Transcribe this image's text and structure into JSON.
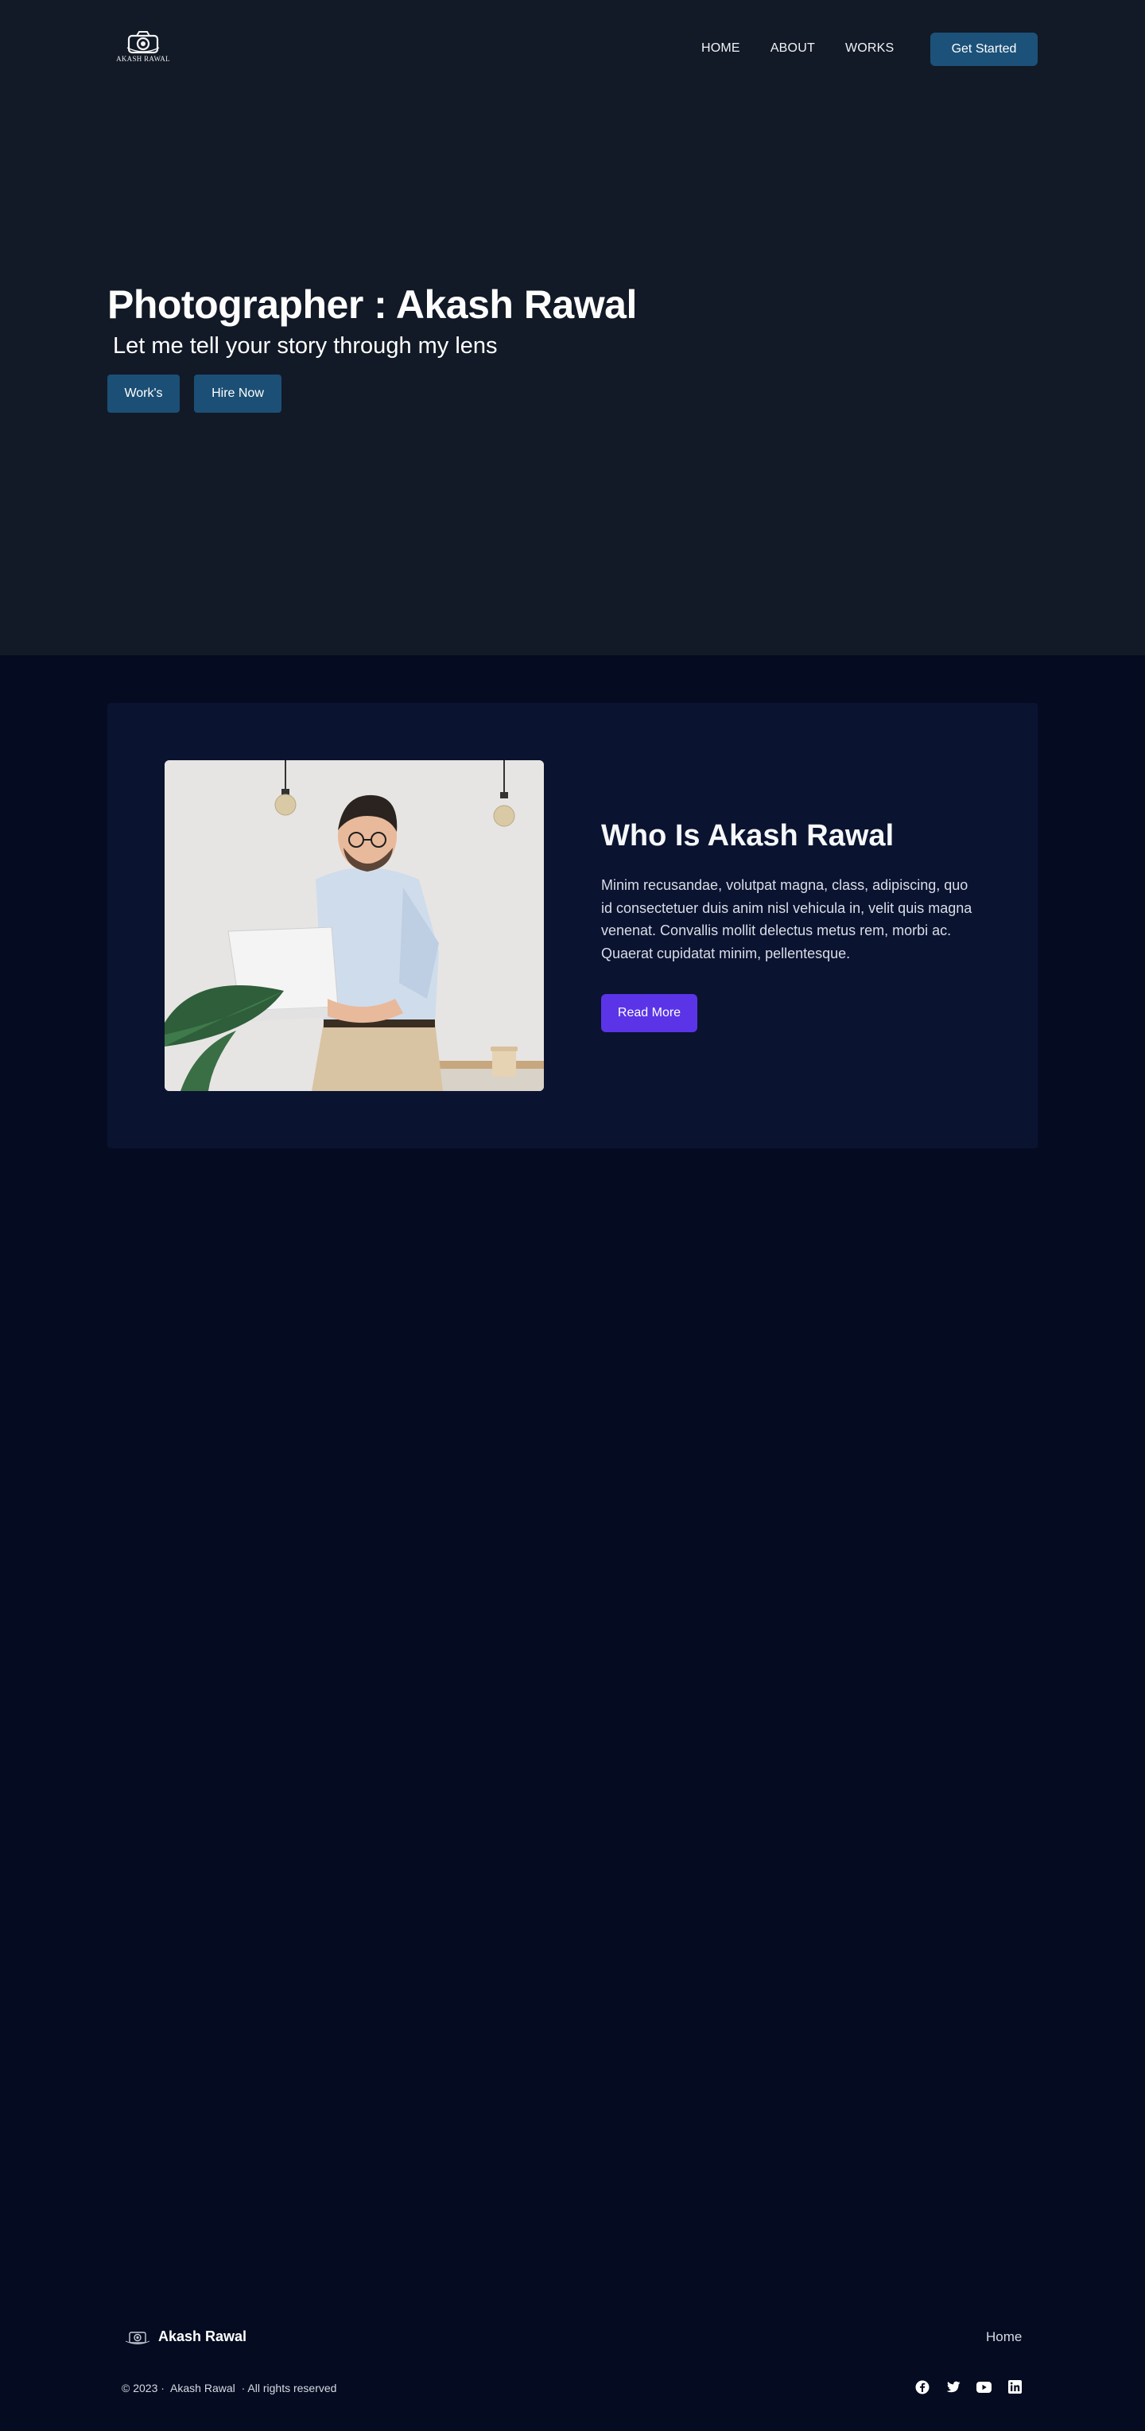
{
  "brand": {
    "logo_text": "AKASH RAWAL",
    "name": "Akash Rawal"
  },
  "nav": {
    "links": [
      "HOME",
      "ABOUT",
      "WORKS"
    ],
    "cta": "Get Started"
  },
  "hero": {
    "title": "Photographer : Akash Rawal",
    "subtitle": "Let me tell your story through my lens",
    "buttons": [
      "Work's",
      "Hire Now"
    ]
  },
  "about": {
    "heading": "Who Is Akash Rawal",
    "body": "Minim recusandae, volutpat magna, class, adipiscing, quo id consectetuer duis anim nisl vehicula in, velit quis magna venenat. Convallis mollit delectus metus rem, morbi ac. Quaerat cupidatat minim, pellentesque.",
    "button": "Read More"
  },
  "footer": {
    "brand": "Akash Rawal",
    "link": "Home",
    "copyright_year": "© 2023 ·",
    "copyright_name": "Akash Rawal",
    "copyright_rights": "· All rights reserved",
    "social": [
      "facebook-icon",
      "twitter-icon",
      "youtube-icon",
      "linkedin-icon"
    ]
  },
  "colors": {
    "hero_bg": "#131a27",
    "page_bg": "#050c21",
    "card_bg": "#0a1430",
    "nav_button": "#1c5279",
    "accent_purple": "#5a34e6"
  }
}
